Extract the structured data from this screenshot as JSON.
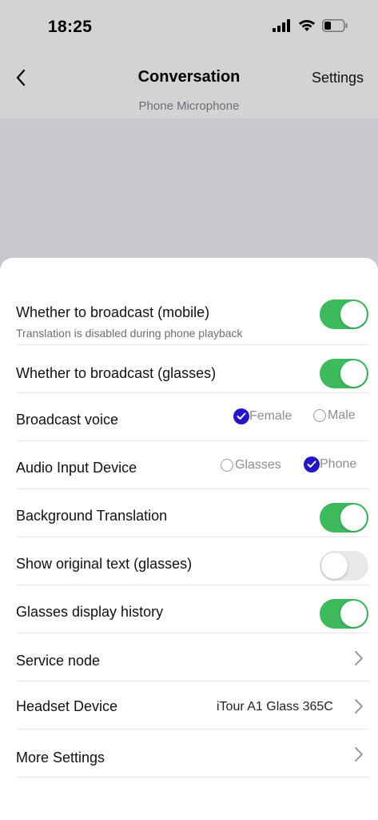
{
  "status_bar": {
    "time": "18:25"
  },
  "nav": {
    "title": "Conversation",
    "settings_label": "Settings",
    "subtitle": "Phone Microphone"
  },
  "sheet": {
    "broadcast_mobile": {
      "label": "Whether to broadcast (mobile)",
      "sub": "Translation is disabled during phone playback",
      "on": true
    },
    "broadcast_glasses": {
      "label": "Whether to broadcast (glasses)",
      "on": true
    },
    "broadcast_voice": {
      "label": "Broadcast voice",
      "options": [
        {
          "label": "Female",
          "selected": true
        },
        {
          "label": "Male",
          "selected": false
        }
      ]
    },
    "audio_input": {
      "label": "Audio Input Device",
      "options": [
        {
          "label": "Glasses",
          "selected": false
        },
        {
          "label": "Phone",
          "selected": true
        }
      ]
    },
    "background_translation": {
      "label": "Background Translation",
      "on": true
    },
    "show_original": {
      "label": "Show original text (glasses)",
      "on": false
    },
    "glasses_history": {
      "label": "Glasses display history",
      "on": true
    },
    "service_node": {
      "label": "Service node"
    },
    "headset_device": {
      "label": "Headset Device",
      "value": "iTour A1 Glass 365C"
    },
    "more_settings": {
      "label": "More Settings"
    }
  },
  "colors": {
    "toggle_on": "#3cba5c",
    "toggle_off": "#e9e9eb",
    "radio_selected": "#2316c9"
  }
}
